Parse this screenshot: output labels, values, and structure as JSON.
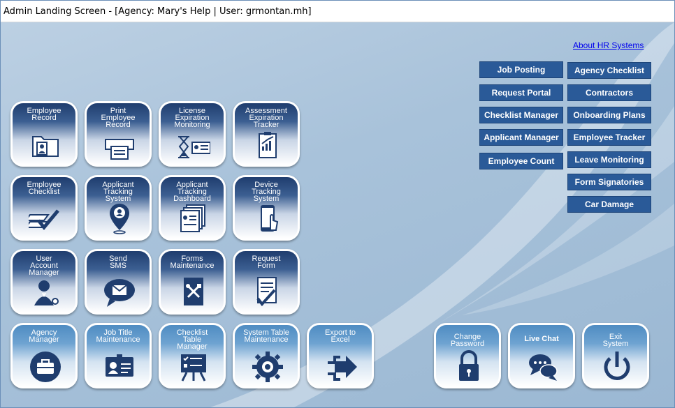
{
  "window": {
    "title": "Admin Landing Screen - [Agency: Mary's Help | User: grmontan.mh]"
  },
  "about_link": "About HR Systems",
  "buttons_left": [
    "Job Posting",
    "Request Portal",
    "Checklist Manager",
    "Applicant Manager",
    "Employee Count"
  ],
  "buttons_right": [
    "Agency Checklist",
    "Contractors",
    "Onboarding Plans",
    "Employee Tracker",
    "Leave Monitoring",
    "Form Signatories",
    "Car Damage"
  ],
  "tiles": {
    "employee_record": "Employee\nRecord",
    "print_employee_record": "Print\nEmployee\nRecord",
    "license_expiration": "License\nExpiration\nMonitoring",
    "assessment_expiration": "Assessment\nExpiration\nTracker",
    "employee_checklist": "Employee\nChecklist",
    "applicant_tracking_system": "Applicant\nTracking\nSystem",
    "applicant_tracking_dashboard": "Applicant\nTracking\nDashboard",
    "device_tracking": "Device\nTracking\nSystem",
    "user_account_manager": "User\nAccount\nManager",
    "send_sms": "Send\nSMS",
    "forms_maintenance": "Forms\nMaintenance",
    "request_form": "Request\nForm",
    "agency_manager": "Agency\nManager",
    "job_title_maintenance": "Job Title\nMaintenance",
    "checklist_table_manager": "Checklist\nTable\nManager",
    "system_table_maintenance": "System Table\nMaintenance",
    "export_to_excel": "Export to\nExcel",
    "change_password": "Change\nPassword",
    "live_chat": "Live Chat",
    "exit_system": "Exit\nSystem"
  },
  "colors": {
    "button": "#2a5a98",
    "tile_dark": "#1f3d6e",
    "tile_light": "#4f8cc2",
    "icon": "#1f3d6e"
  }
}
